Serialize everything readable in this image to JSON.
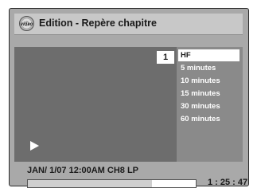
{
  "header": {
    "icon_label": "video",
    "title": "Edition - Repère chapitre"
  },
  "video": {
    "chapter_number": "1",
    "play_icon": "play-icon"
  },
  "menu": {
    "items": [
      {
        "label": "HF",
        "selected": true
      },
      {
        "label": "5 minutes",
        "selected": false
      },
      {
        "label": "10 minutes",
        "selected": false
      },
      {
        "label": "15 minutes",
        "selected": false
      },
      {
        "label": "30 minutes",
        "selected": false
      },
      {
        "label": "60 minutes",
        "selected": false
      }
    ]
  },
  "status": {
    "info": "JAN/ 1/07 12:00AM CH8   LP",
    "time": "1 : 25 : 47",
    "progress_fraction": 0.74
  },
  "colors": {
    "panel_bg": "#a9a9a9",
    "video_bg": "#6d6d6d",
    "menu_bg": "#8a8a8a",
    "highlight": "#ffffff"
  }
}
